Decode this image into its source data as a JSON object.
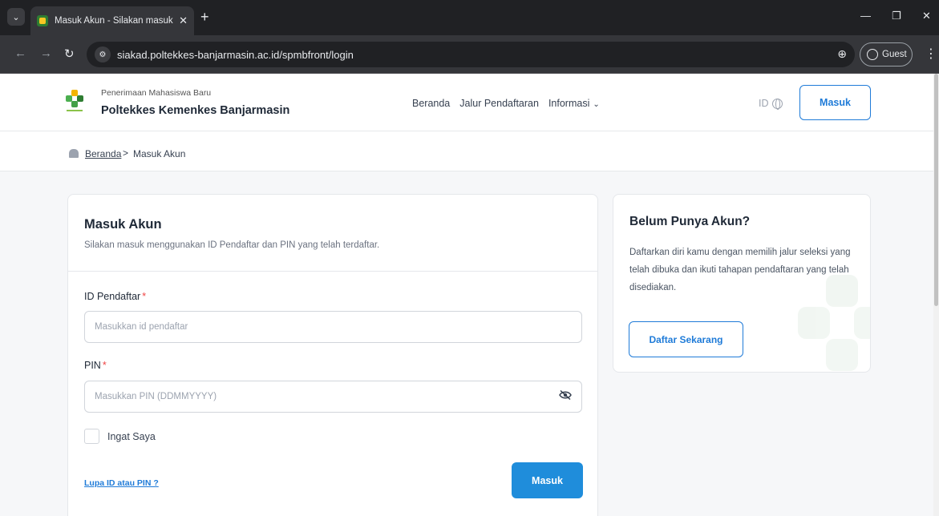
{
  "browser": {
    "tab_title": "Masuk Akun - Silakan masuk m",
    "url": "siakad.poltekkes-banjarmasin.ac.id/spmbfront/login",
    "profile_label": "Guest"
  },
  "header": {
    "brand_subtitle": "Penerimaan Mahasiswa Baru",
    "brand_name": "Poltekkes Kemenkes Banjarmasin",
    "nav": {
      "home": "Beranda",
      "admission_paths": "Jalur Pendaftaran",
      "info": "Informasi"
    },
    "language": "ID",
    "login_button": "Masuk"
  },
  "breadcrumb": {
    "home": "Beranda",
    "separator": ">",
    "current": "Masuk Akun"
  },
  "login_card": {
    "title": "Masuk Akun",
    "subtitle": "Silakan masuk menggunakan ID Pendaftar dan PIN yang telah terdaftar.",
    "id_label": "ID Pendaftar",
    "id_placeholder": "Masukkan id pendaftar",
    "pin_label": "PIN",
    "pin_placeholder": "Masukkan PIN (DDMMYYYY)",
    "required_mark": "*",
    "remember_label": "Ingat Saya",
    "forgot_link": "Lupa ID atau PIN ?",
    "submit_label": "Masuk"
  },
  "register_card": {
    "title": "Belum Punya Akun?",
    "text": "Daftarkan diri kamu dengan memilih jalur seleksi yang telah dibuka dan ikuti tahapan pendaftaran yang telah disediakan.",
    "button": "Daftar Sekarang"
  },
  "colors": {
    "primary": "#1f7bd8",
    "submit_bg": "#1f8ddb",
    "required": "#ef4444",
    "page_bg": "#f6f7f9"
  }
}
